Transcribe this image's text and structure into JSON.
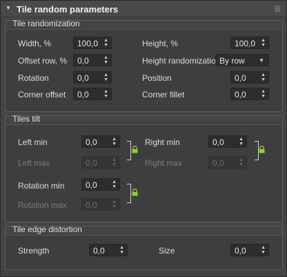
{
  "rollout": {
    "title": "Tile random parameters"
  },
  "tile_randomization": {
    "title": "Tile randomization",
    "width_label": "Width, %",
    "width_value": "100,0",
    "height_label": "Height, %",
    "height_value": "100,0",
    "offset_row_label": "Offset row, %",
    "offset_row_value": "0,0",
    "height_rand_label": "Height randomization",
    "height_rand_value": "By row",
    "rotation_label": "Rotation",
    "rotation_value": "0,0",
    "position_label": "Position",
    "position_value": "0,0",
    "corner_offset_label": "Corner offset",
    "corner_offset_value": "0,0",
    "corner_fillet_label": "Corner fillet",
    "corner_fillet_value": "0,0"
  },
  "tiles_tilt": {
    "title": "Tiles tilt",
    "left_min_label": "Left min",
    "left_min_value": "0,0",
    "left_max_label": "Left max",
    "left_max_value": "0,0",
    "right_min_label": "Right min",
    "right_min_value": "0,0",
    "right_max_label": "Right max",
    "right_max_value": "0,0",
    "rotation_min_label": "Rotation min",
    "rotation_min_value": "0,0",
    "rotation_max_label": "Rotation max",
    "rotation_max_value": "0,0"
  },
  "edge_distortion": {
    "title": "Tile edge distortion",
    "strength_label": "Strength",
    "strength_value": "0,0",
    "size_label": "Size",
    "size_value": "0,0"
  },
  "colors": {
    "lock": "#8fd13a",
    "background": "#444444",
    "field": "#2d2d2d"
  }
}
